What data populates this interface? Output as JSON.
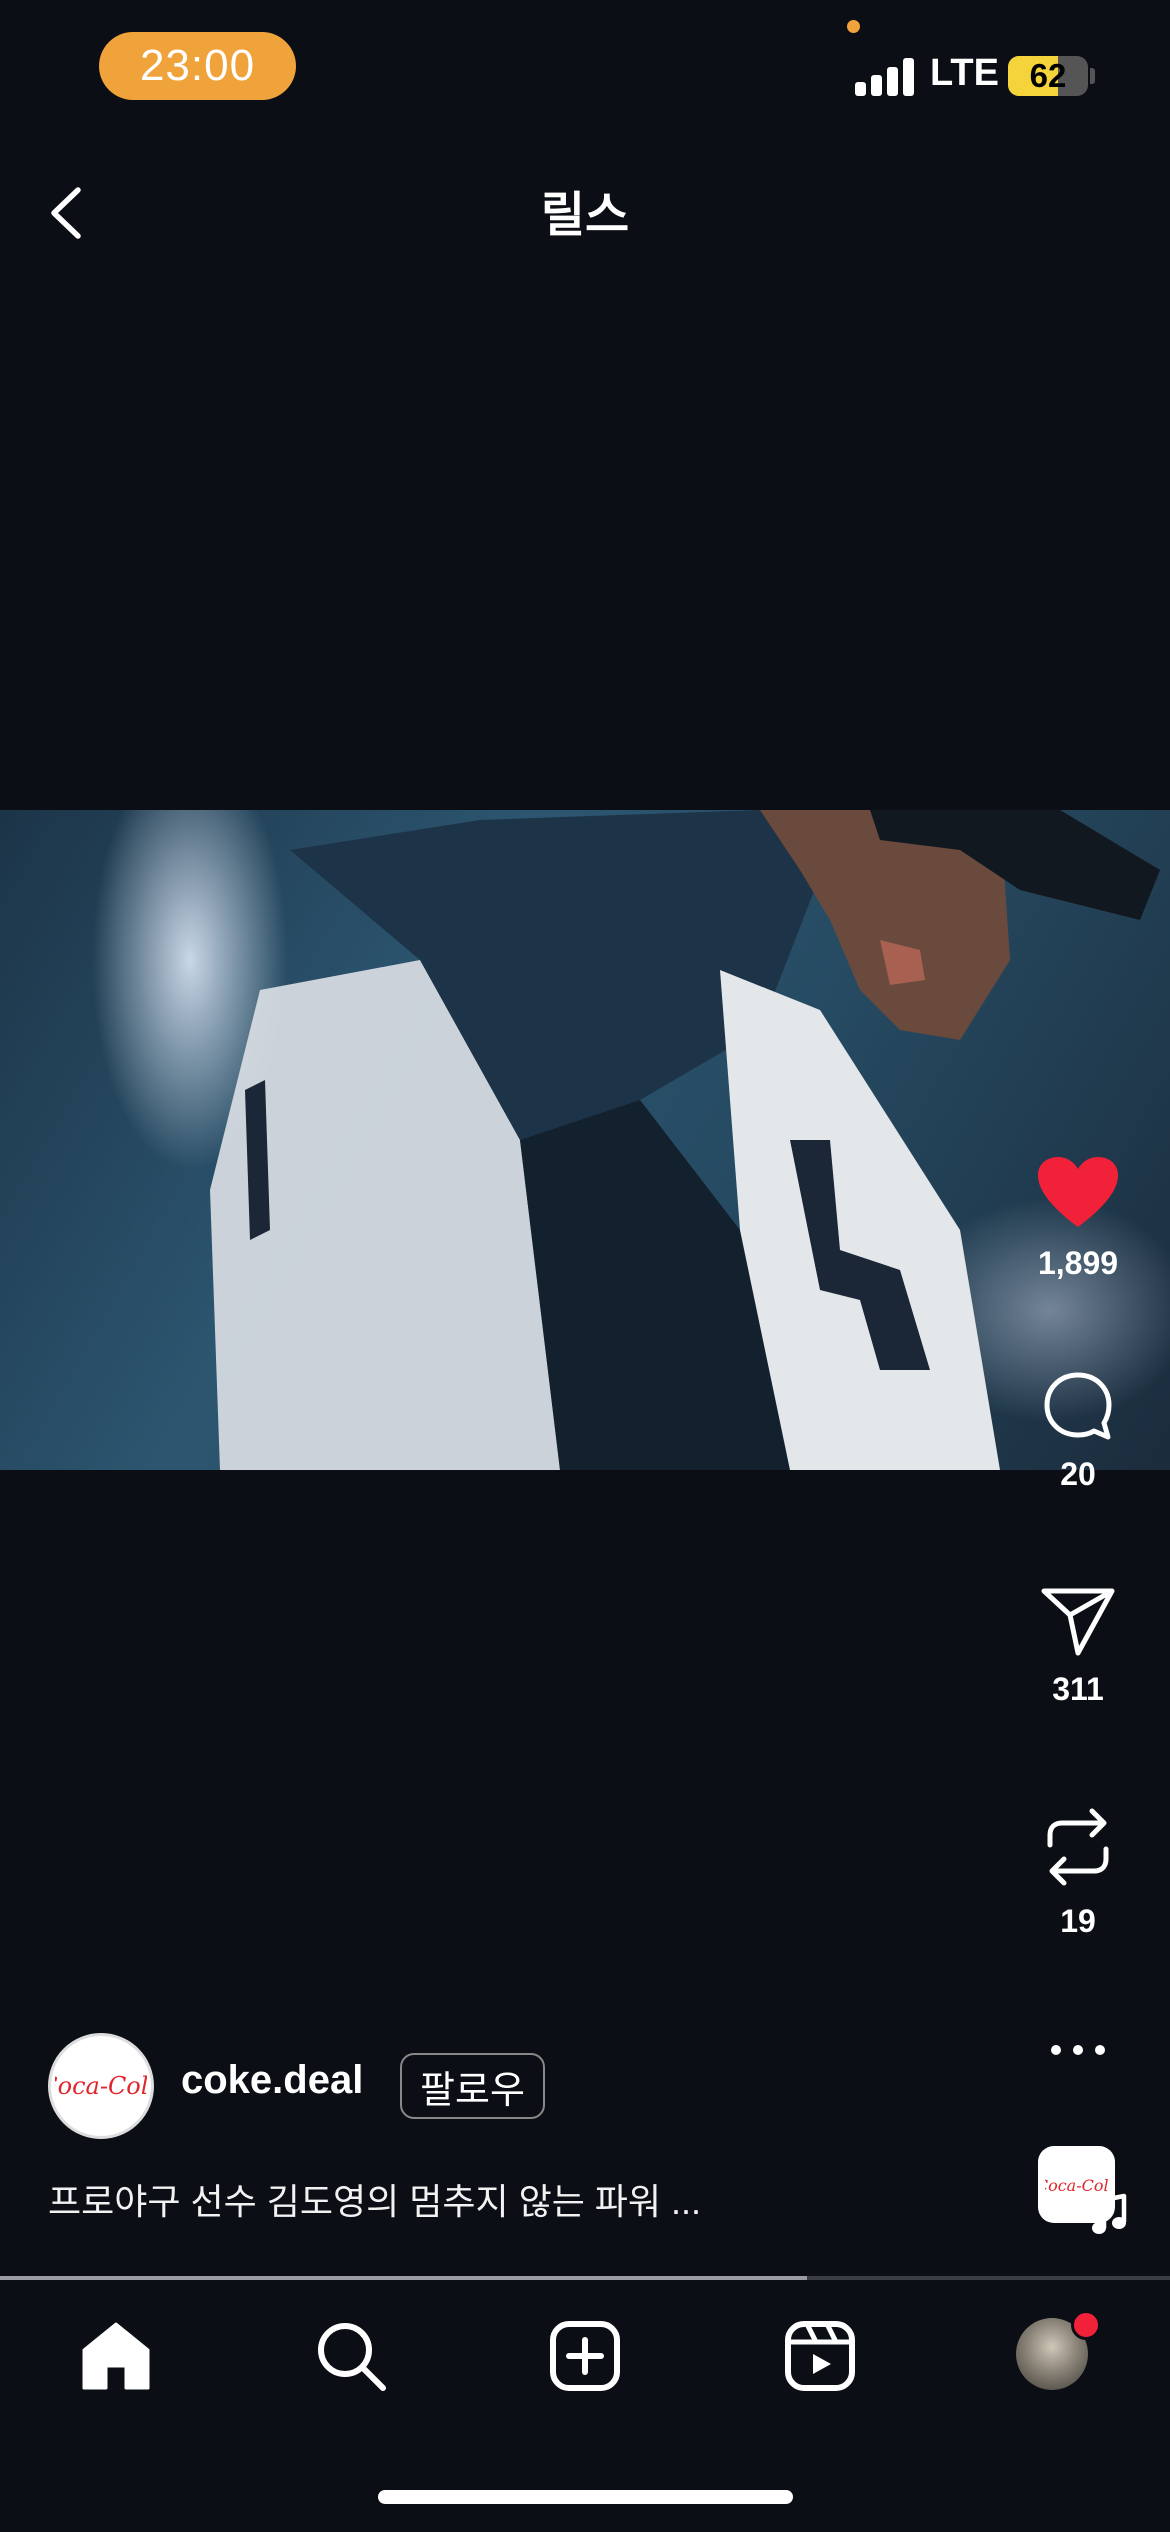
{
  "status_bar": {
    "time": "23:00",
    "network": "LTE",
    "battery": "62",
    "battery_level": 0.62,
    "accent_color": "#f0a33a"
  },
  "header": {
    "title": "릴스",
    "back_icon": "chevron-left-icon"
  },
  "actions": {
    "like": {
      "icon": "heart-icon",
      "count": "1,899",
      "color": "#f2213a"
    },
    "comment": {
      "icon": "comment-bubble-icon",
      "count": "20"
    },
    "share": {
      "icon": "paper-plane-icon",
      "count": "311"
    },
    "remix": {
      "icon": "repost-icon",
      "count": "19"
    },
    "more": {
      "icon": "more-dots-icon"
    }
  },
  "post": {
    "username": "coke.deal",
    "follow_label": "팔로우",
    "caption": "프로야구 선수 김도영의 멈추지 않는 파워 ...",
    "avatar_logo": "Coca-Cola",
    "music_logo": "Coca-Cola"
  },
  "playback": {
    "progress": 0.69
  },
  "tab_bar": {
    "items": [
      "home-icon",
      "search-icon",
      "create-icon",
      "reels-icon",
      "profile-avatar"
    ],
    "notification_color": "#f2213a"
  }
}
